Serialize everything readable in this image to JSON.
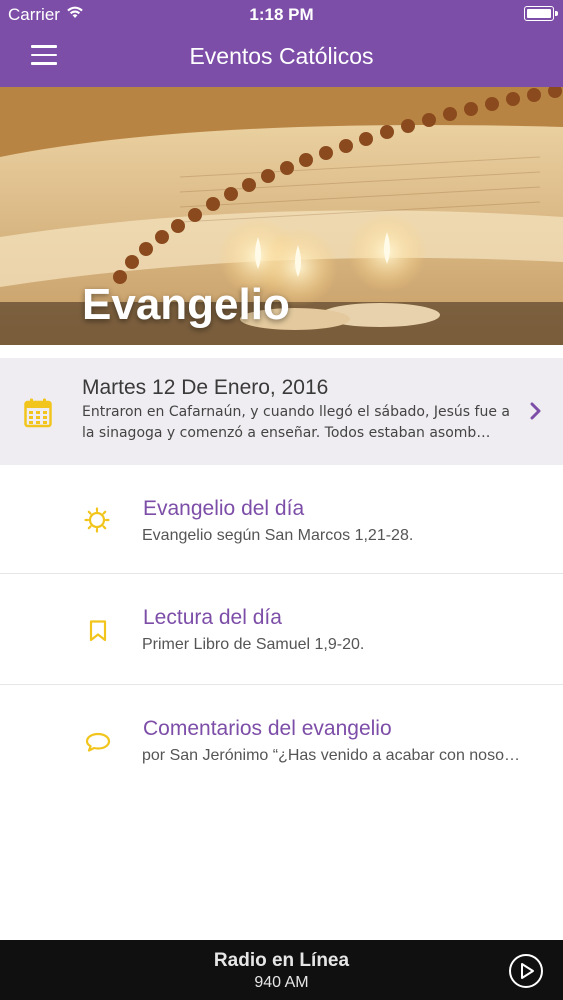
{
  "status_bar": {
    "carrier": "Carrier",
    "time": "1:18 PM"
  },
  "app_bar": {
    "title": "Eventos Católicos",
    "menu_icon": "hamburger-menu-icon"
  },
  "hero": {
    "title": "Evangelio"
  },
  "date_card": {
    "date": "Martes 12 De Enero, 2016",
    "snippet": "Entraron en Cafarnaún, y cuando llegó el sábado, Jesús fue a la sinagoga y comenzó a enseñar. Todos estaban asomb…",
    "icon": "calendar-icon",
    "chevron": "chevron-right-icon"
  },
  "items": [
    {
      "title": "Evangelio del día",
      "subtitle": "Evangelio según San Marcos 1,21-28.",
      "icon": "sun-icon"
    },
    {
      "title": "Lectura del día",
      "subtitle": "Primer Libro de Samuel 1,9-20.",
      "icon": "bookmark-icon"
    },
    {
      "title": "Comentarios del evangelio",
      "subtitle": "por San Jerónimo “¿Has venido a acabar con noso…",
      "icon": "speech-bubble-icon"
    }
  ],
  "radio": {
    "title": "Radio en Línea",
    "subtitle": "940 AM",
    "icon": "play-circle-icon"
  },
  "colors": {
    "brand": "#7d4ea8",
    "accent_icon": "#f2c51c",
    "date_background": "#efedf1",
    "footer": "#101010"
  }
}
